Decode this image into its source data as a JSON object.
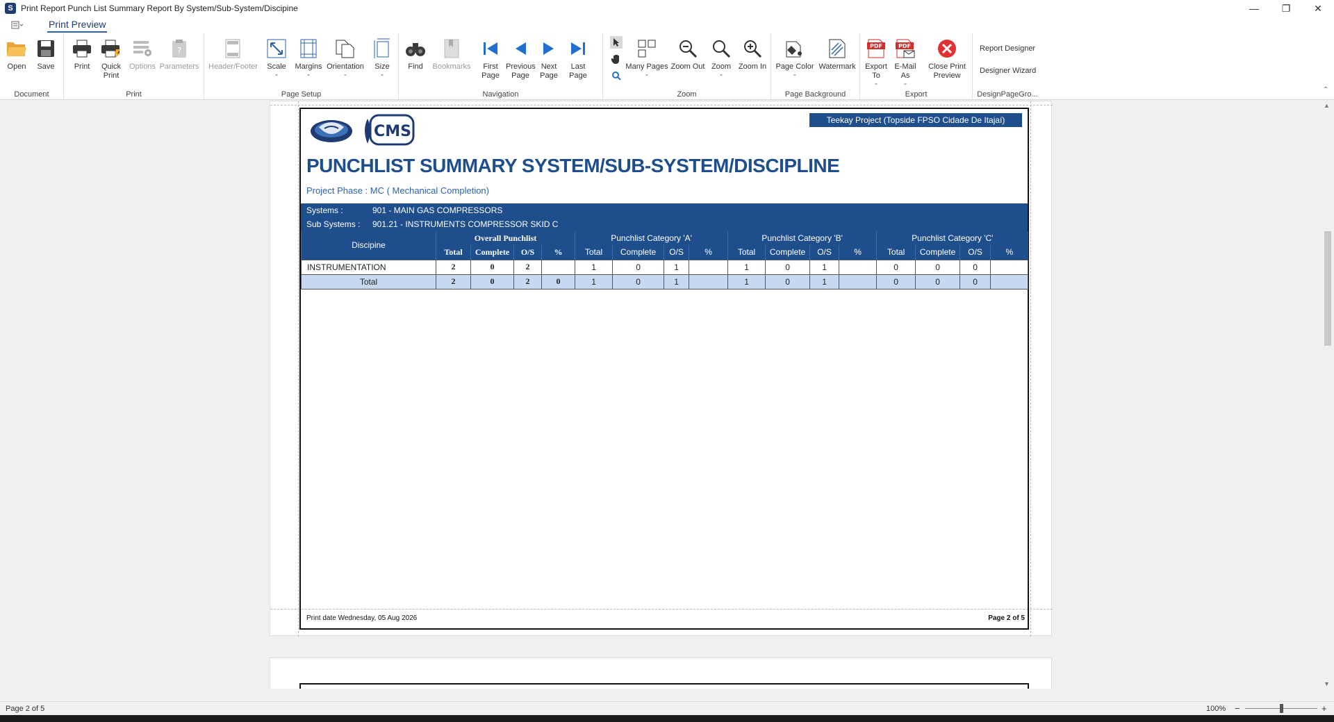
{
  "window": {
    "title": "Print Report Punch List Summary Report By System/Sub-System/Discipine",
    "minimize": "—",
    "restore": "❐",
    "close": "✕"
  },
  "ribbon": {
    "tab": "Print Preview",
    "groups": {
      "document": "Document",
      "print": "Print",
      "page_setup": "Page Setup",
      "navigation": "Navigation",
      "zoom": "Zoom",
      "page_background": "Page Background",
      "export": "Export",
      "design": "DesignPageGro..."
    },
    "buttons": {
      "open": "Open",
      "save": "Save",
      "print": "Print",
      "quick_print": "Quick Print",
      "options": "Options",
      "parameters": "Parameters",
      "header_footer": "Header/Footer",
      "scale": "Scale",
      "margins": "Margins",
      "orientation": "Orientation",
      "size": "Size",
      "find": "Find",
      "bookmarks": "Bookmarks",
      "first_page": "First Page",
      "previous_page": "Previous Page",
      "next_page": "Next Page",
      "last_page": "Last Page",
      "many_pages": "Many Pages",
      "zoom_out": "Zoom Out",
      "zoom": "Zoom",
      "zoom_in": "Zoom In",
      "page_color": "Page Color",
      "watermark": "Watermark",
      "export_to": "Export To",
      "email_as": "E-Mail As",
      "close_print_preview": "Close Print Preview",
      "report_designer": "Report Designer",
      "designer_wizard": "Designer Wizard"
    }
  },
  "report": {
    "project_box": "Teekay Project (Topside FPSO Cidade De Itajaí)",
    "logo_text": "CMS",
    "title": "PUNCHLIST SUMMARY SYSTEM/SUB-SYSTEM/DISCIPLINE",
    "phase": "Project Phase : MC ( Mechanical Completion)",
    "systems_label": "Systems :",
    "systems_value": "901 - MAIN GAS COMPRESSORS",
    "subsystems_label": "Sub Systems :",
    "subsystems_value": "901.21 - INSTRUMENTS COMPRESSOR SKID C",
    "headers": {
      "discipline": "Discipine",
      "overall": "Overall Punchlist",
      "cat_a": "Punchlist Category 'A'",
      "cat_b": "Punchlist Category 'B'",
      "cat_c": "Punchlist Category 'C'",
      "total": "Total",
      "complete": "Complete",
      "os": "O/S",
      "pct": "%"
    },
    "rows": [
      {
        "discipline": "INSTRUMENTATION",
        "overall": [
          "2",
          "0",
          "2",
          ""
        ],
        "a": [
          "1",
          "0",
          "1",
          ""
        ],
        "b": [
          "1",
          "0",
          "1",
          ""
        ],
        "c": [
          "0",
          "0",
          "0",
          ""
        ]
      }
    ],
    "total_row": {
      "label": "Total",
      "overall": [
        "2",
        "0",
        "2",
        "0"
      ],
      "a": [
        "1",
        "0",
        "1",
        ""
      ],
      "b": [
        "1",
        "0",
        "1",
        ""
      ],
      "c": [
        "0",
        "0",
        "0",
        ""
      ]
    },
    "print_date": "Print date Wednesday, 05 Aug 2026",
    "page_footer": "Page 2 of 5"
  },
  "status": {
    "page": "Page 2 of 5",
    "zoom": "100%",
    "zoom_minus": "−",
    "zoom_plus": "+"
  },
  "colors": {
    "accent": "#1f4e8c",
    "total_row": "#c6d9f1",
    "close_red": "#e03232",
    "pdf_red": "#d62b2b",
    "nav_blue": "#1f6fd1"
  }
}
